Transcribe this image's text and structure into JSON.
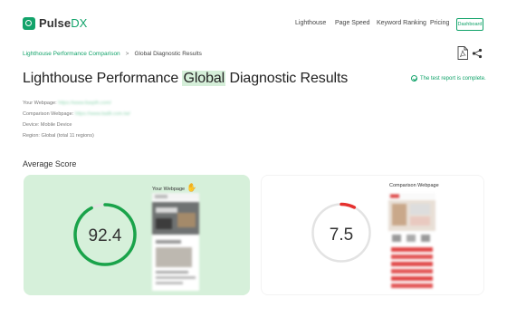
{
  "header": {
    "logo_main": "Pulse",
    "logo_accent": "DX",
    "nav": [
      "Lighthouse",
      "Page Speed",
      "Keyword Ranking",
      "Pricing"
    ],
    "dashboard_label": "Dashboard"
  },
  "breadcrumb": {
    "parent": "Lighthouse Performance Comparison",
    "separator": ">",
    "current": "Global Diagnostic Results"
  },
  "title": {
    "before": "Lighthouse Performance ",
    "highlight": "Global",
    "after": " Diagnostic Results"
  },
  "status": {
    "text": "The test report is complete."
  },
  "meta": {
    "webpage_label": "Your Webpage:",
    "webpage_value": "https://www.liasplh.com/",
    "comparison_label": "Comparison Webpage:",
    "comparison_value": "https://www.bailli.com.tw/",
    "device": "Device: Mobile Device",
    "region": "Region: Global (total 11 regions)"
  },
  "section": {
    "title": "Average Score"
  },
  "yours": {
    "score": "92.4",
    "score_fraction": 0.924,
    "thumb_label": "Your Webpage",
    "ring_color": "#1aa34a"
  },
  "comparison": {
    "score": "7.5",
    "score_fraction": 0.075,
    "thumb_label": "Comparison Webpage",
    "ring_color": "#e5312f"
  },
  "colors": {
    "accent": "#12a36a",
    "card_yours": "#d6f0da",
    "track": "#e3e3e3"
  },
  "icons": {
    "pdf": "pdf-icon",
    "share": "share-icon",
    "check": "check-circle-icon",
    "wave": "waving-hand-icon"
  }
}
